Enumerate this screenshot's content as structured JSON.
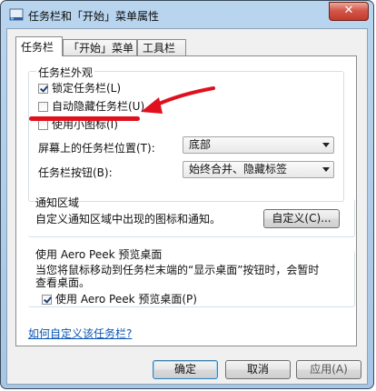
{
  "window": {
    "title": "任务栏和「开始」菜单属性",
    "close_label": "✕"
  },
  "tabs": [
    {
      "label": "任务栏",
      "active": true
    },
    {
      "label": "「开始」菜单",
      "active": false
    },
    {
      "label": "工具栏",
      "active": false
    }
  ],
  "appearance": {
    "group_title": "任务栏外观",
    "lock_label": "锁定任务栏(L)",
    "lock_checked": true,
    "autohide_label": "自动隐藏任务栏(U)",
    "autohide_checked": false,
    "small_icons_label": "使用小图标(I)",
    "small_icons_checked": false,
    "location_label": "屏幕上的任务栏位置(T):",
    "location_value": "底部",
    "buttons_label": "任务栏按钮(B):",
    "buttons_value": "始终合并、隐藏标签"
  },
  "notification": {
    "group_title": "通知区域",
    "description": "自定义通知区域中出现的图标和通知。",
    "customize_label": "自定义(C)..."
  },
  "aero": {
    "group_title": "使用 Aero Peek 预览桌面",
    "description_line1": "当您将鼠标移动到任务栏末端的“显示桌面”按钮时，会暂时",
    "description_line2": "查看桌面。",
    "checkbox_label": "使用 Aero Peek 预览桌面(P)",
    "checkbox_checked": true
  },
  "help_link": "如何自定义该任务栏?",
  "footer": {
    "ok_label": "确定",
    "cancel_label": "取消",
    "apply_label": "应用(A)"
  },
  "colors": {
    "annotation": "#e0101e",
    "titlebar": "#b9d5ee",
    "link": "#0b56b5"
  }
}
